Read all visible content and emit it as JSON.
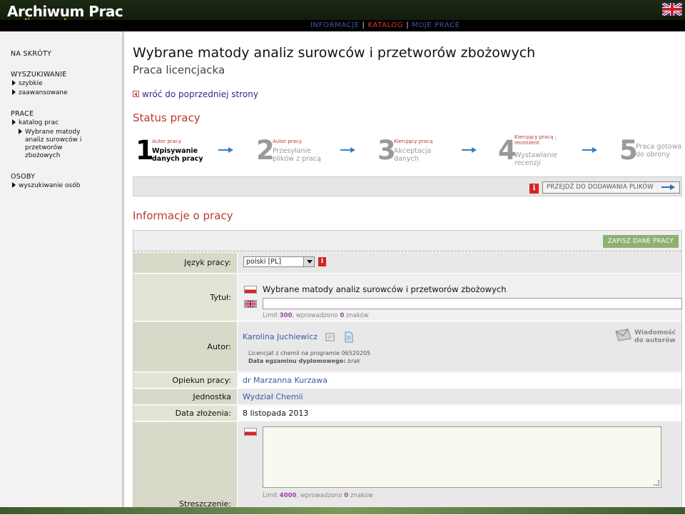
{
  "app": {
    "title": "Archiwum Prac",
    "subtitle": "lic mgr dr"
  },
  "topnav": {
    "items": [
      "INFORMACJE",
      "KATALOG",
      "MOJE PRACE"
    ],
    "active": "KATALOG",
    "separator": "|"
  },
  "sidebar": {
    "sections": [
      {
        "title": "NA SKRÓTY",
        "items": []
      },
      {
        "title": "WYSZUKIWANIE",
        "items": [
          "szybkie",
          "zaawansowane"
        ]
      },
      {
        "title": "PRACE",
        "items": [
          "katalog prac"
        ],
        "subitems": [
          "Wybrane matody analiz surowców i przetworów zbożowych"
        ]
      },
      {
        "title": "OSOBY",
        "items": [
          "wyszukiwanie osób"
        ]
      }
    ]
  },
  "page": {
    "title": "Wybrane matody analiz surowców i przetworów zbożowych",
    "subtitle": "Praca licencjacka",
    "back_link": "wróć do poprzedniej strony"
  },
  "status": {
    "title": "Status pracy",
    "steps": [
      {
        "num": "1",
        "role": "Autor pracy",
        "desc_line1": "Wpisywanie",
        "desc_line2": "danych pracy",
        "active": true
      },
      {
        "num": "2",
        "role": "Autor pracy",
        "desc_line1": "Przesyłanie",
        "desc_line2": "plików z pracą",
        "active": false
      },
      {
        "num": "3",
        "role": "Kierujący pracą",
        "desc_line1": "Akceptacja",
        "desc_line2": "danych",
        "active": false
      },
      {
        "num": "4",
        "role": "Kierujący pracą ; recenzent",
        "desc_line1": "Wystawianie",
        "desc_line2": "recenzji",
        "active": false
      },
      {
        "num": "5",
        "role": "",
        "desc_line1": "Praca gotowa",
        "desc_line2": "do obrony",
        "active": false
      }
    ],
    "next_button": "PRZEJDŹ DO DODAWANIA PLIKÓW",
    "info_icon": "i"
  },
  "info": {
    "title": "Informacje o pracy",
    "save_button": "ZAPISZ DANE PRACY",
    "fields": {
      "language_label": "Język pracy:",
      "language_value": "polski [PL]",
      "title_label": "Tytuł:",
      "title_pl": "Wybrane matody analiz surowców i przetworów zbożowych",
      "title_en": "",
      "title_limit_prefix": "Limit",
      "title_limit": "300",
      "title_limit_mid": ", wprowadzono",
      "title_count": "0",
      "title_limit_suffix": "znaków",
      "author_label": "Autor:",
      "author_name": "Karolina Juchiewicz",
      "author_program": "Licencjat z chemii na programie 06520205",
      "exam_label": "Data egzaminu dyplomowego:",
      "exam_value": "brak",
      "message_line1": "Wiadomość",
      "message_line2": "do autorów",
      "supervisor_label": "Opiekun pracy:",
      "supervisor_value": "dr Marzanna Kurzawa",
      "unit_label": "Jednostka organizacyjna:",
      "unit_value": "Wydział Chemii",
      "date_label": "Data złożenia:",
      "date_value": "8 listopada 2013",
      "abstract_label": "Streszczenie:",
      "abstract_value": "",
      "abstract_limit": "4000",
      "abstract_count": "0"
    }
  },
  "colors": {
    "header_bg": "#1c2a14",
    "logo_sub": "#f2a400",
    "active_nav": "#e2372b",
    "section_title": "#bb3a2f",
    "save_button": "#8fb073",
    "label_bg": "#d9d9c9",
    "link": "#3a58a8"
  }
}
